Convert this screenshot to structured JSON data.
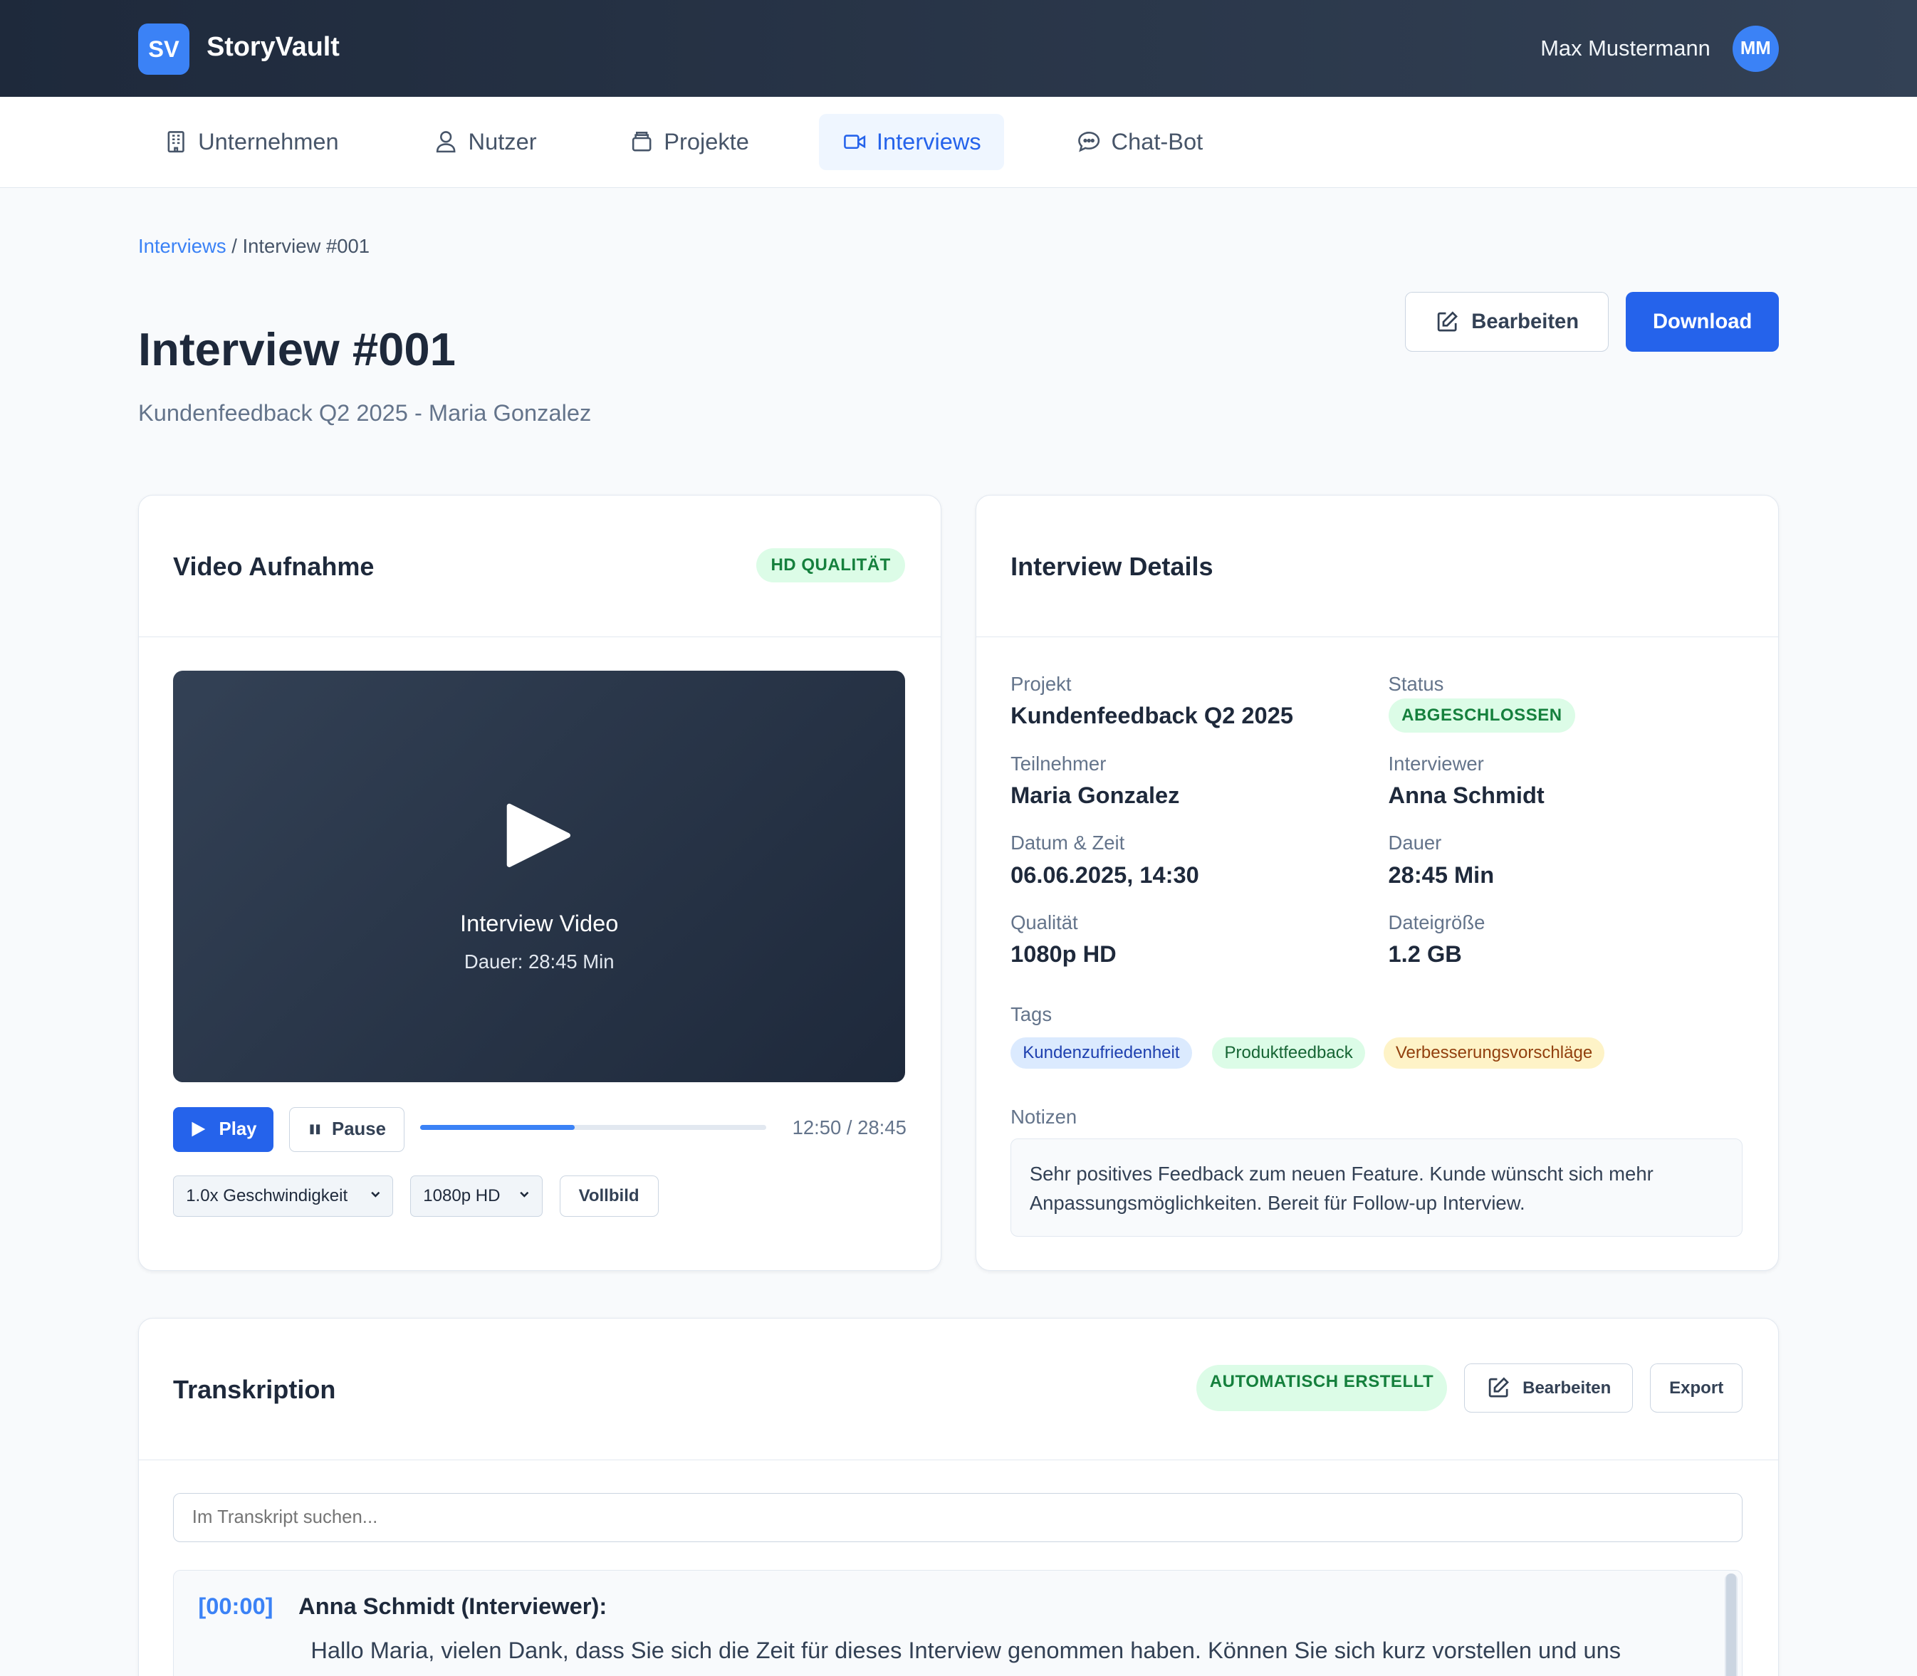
{
  "app": {
    "logo": "SV",
    "name": "StoryVault"
  },
  "user": {
    "name": "Max Mustermann",
    "initials": "MM"
  },
  "nav": [
    {
      "label": "Unternehmen",
      "icon": "building-icon"
    },
    {
      "label": "Nutzer",
      "icon": "user-icon"
    },
    {
      "label": "Projekte",
      "icon": "folder-icon"
    },
    {
      "label": "Interviews",
      "icon": "video-icon",
      "active": true
    },
    {
      "label": "Chat-Bot",
      "icon": "chat-icon"
    }
  ],
  "breadcrumb": {
    "parent": "Interviews",
    "separator": " / ",
    "current": "Interview #001"
  },
  "page": {
    "title": "Interview #001",
    "subtitle": "Kundenfeedback Q2 2025 - Maria Gonzalez"
  },
  "actions": {
    "edit": "Bearbeiten",
    "download": "Download"
  },
  "video": {
    "title": "Video Aufnahme",
    "badge": "HD QUALITÄT",
    "label": "Interview Video",
    "duration": "Dauer: 28:45 Min",
    "play": "Play",
    "pause": "Pause",
    "progress": 0.446,
    "time": "12:50 / 28:45",
    "speed": "1.0x Geschwindigkeit",
    "quality": "1080p HD",
    "fullscreen": "Vollbild"
  },
  "details": {
    "title": "Interview Details",
    "fields": {
      "projekt": {
        "label": "Projekt",
        "value": "Kundenfeedback Q2 2025"
      },
      "status": {
        "label": "Status",
        "value": "ABGESCHLOSSEN"
      },
      "teilnehmer": {
        "label": "Teilnehmer",
        "value": "Maria Gonzalez"
      },
      "interviewer": {
        "label": "Interviewer",
        "value": "Anna Schmidt"
      },
      "datum": {
        "label": "Datum & Zeit",
        "value": "06.06.2025, 14:30"
      },
      "dauer": {
        "label": "Dauer",
        "value": "28:45 Min"
      },
      "qualitaet": {
        "label": "Qualität",
        "value": "1080p HD"
      },
      "dateigroesse": {
        "label": "Dateigröße",
        "value": "1.2 GB"
      }
    },
    "tags_label": "Tags",
    "tags": [
      "Kundenzufriedenheit",
      "Produktfeedback",
      "Verbesserungsvorschläge"
    ],
    "notes_label": "Notizen",
    "notes": "Sehr positives Feedback zum neuen Feature. Kunde wünscht sich mehr Anpassungsmöglichkeiten. Bereit für Follow-up Interview."
  },
  "transcript": {
    "title": "Transkription",
    "badge": "AUTOMATISCH ERSTELLT",
    "edit": "Bearbeiten",
    "export": "Export",
    "search_placeholder": "Im Transkript suchen...",
    "entries": [
      {
        "time": "[00:00]",
        "speaker": "Anna Schmidt (Interviewer):",
        "text": "Hallo Maria, vielen Dank, dass Sie sich die Zeit für dieses Interview genommen haben. Können Sie sich kurz vorstellen und uns"
      }
    ]
  },
  "colors": {
    "accent": "#2563eb",
    "header": "#1e293b",
    "success": "#15803d"
  }
}
